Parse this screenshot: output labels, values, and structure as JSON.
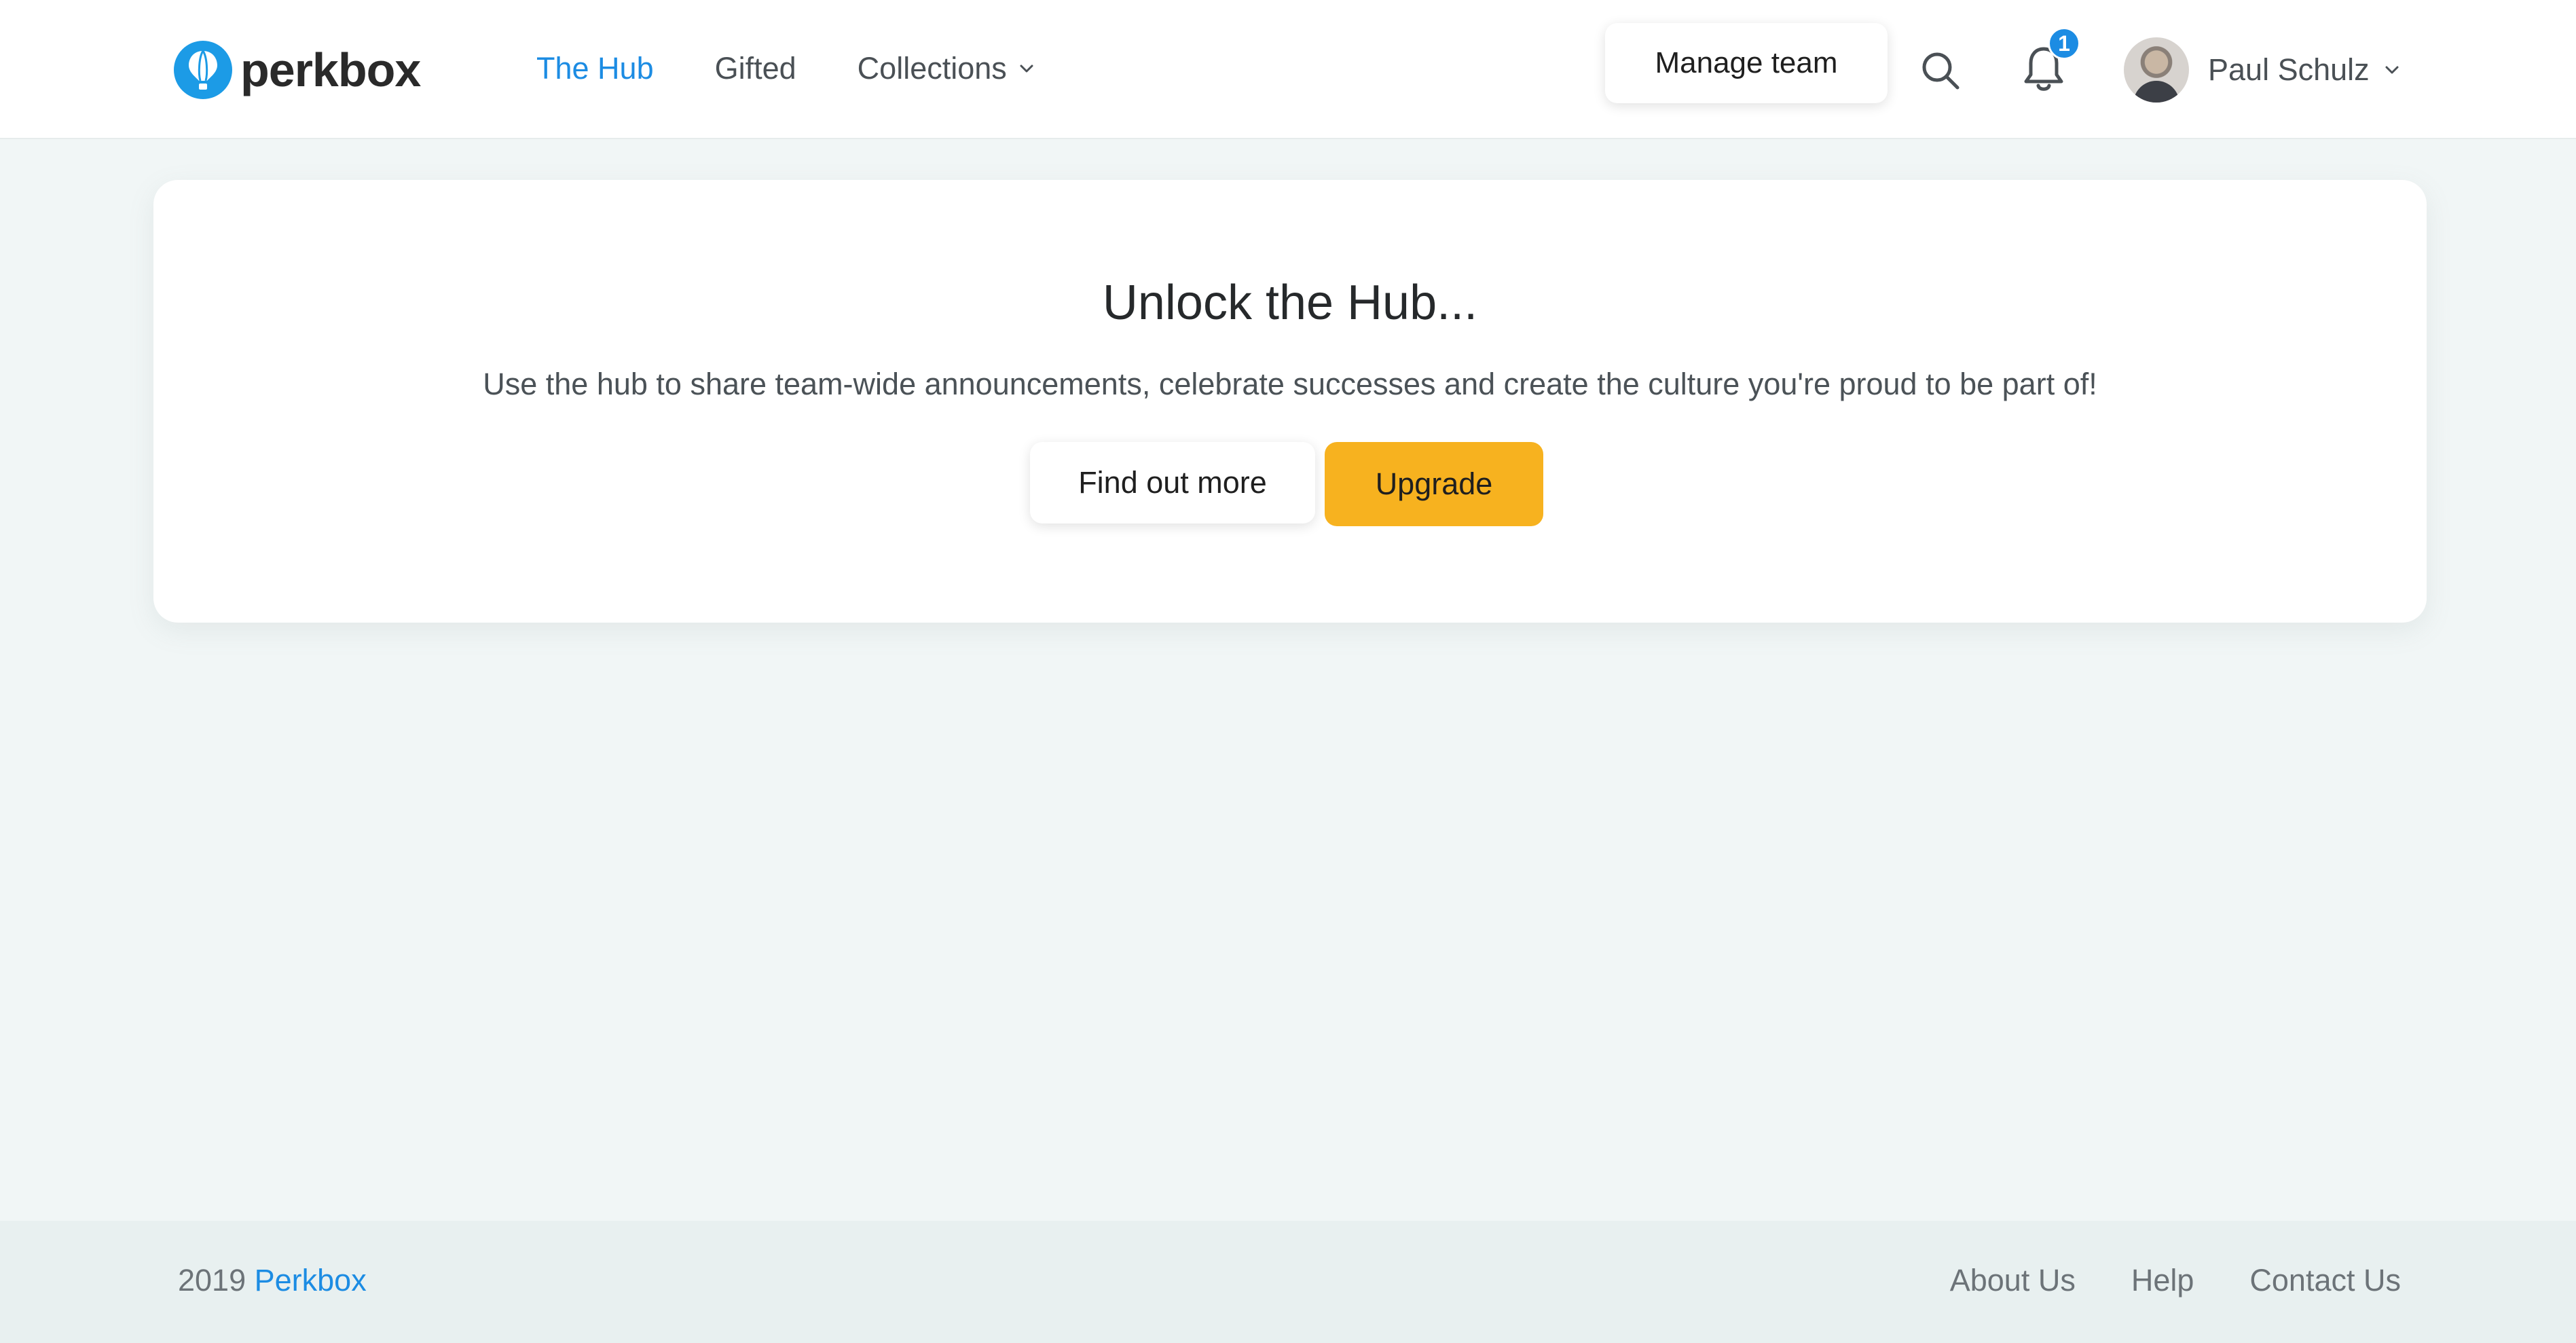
{
  "brand": {
    "name": "perkbox",
    "accent_color": "#1c8ce3",
    "logo_icon": "hot-air-balloon-icon"
  },
  "nav": {
    "items": [
      {
        "label": "The Hub",
        "active": true
      },
      {
        "label": "Gifted",
        "active": false
      },
      {
        "label": "Collections",
        "active": false,
        "has_dropdown": true
      }
    ]
  },
  "header": {
    "manage_team_label": "Manage team",
    "search_icon": "search-icon",
    "notifications": {
      "icon": "bell-icon",
      "count": "1"
    },
    "user": {
      "name": "Paul Schulz",
      "avatar_icon": "avatar"
    }
  },
  "hero": {
    "title": "Unlock the Hub...",
    "description": "Use the hub to share team-wide announcements, celebrate successes and create the culture you're proud to be part of!",
    "secondary_button": "Find out more",
    "primary_button": "Upgrade",
    "primary_color": "#f7b21f"
  },
  "footer": {
    "year": "2019",
    "brand_link": "Perkbox",
    "links": [
      "About Us",
      "Help",
      "Contact Us"
    ]
  }
}
